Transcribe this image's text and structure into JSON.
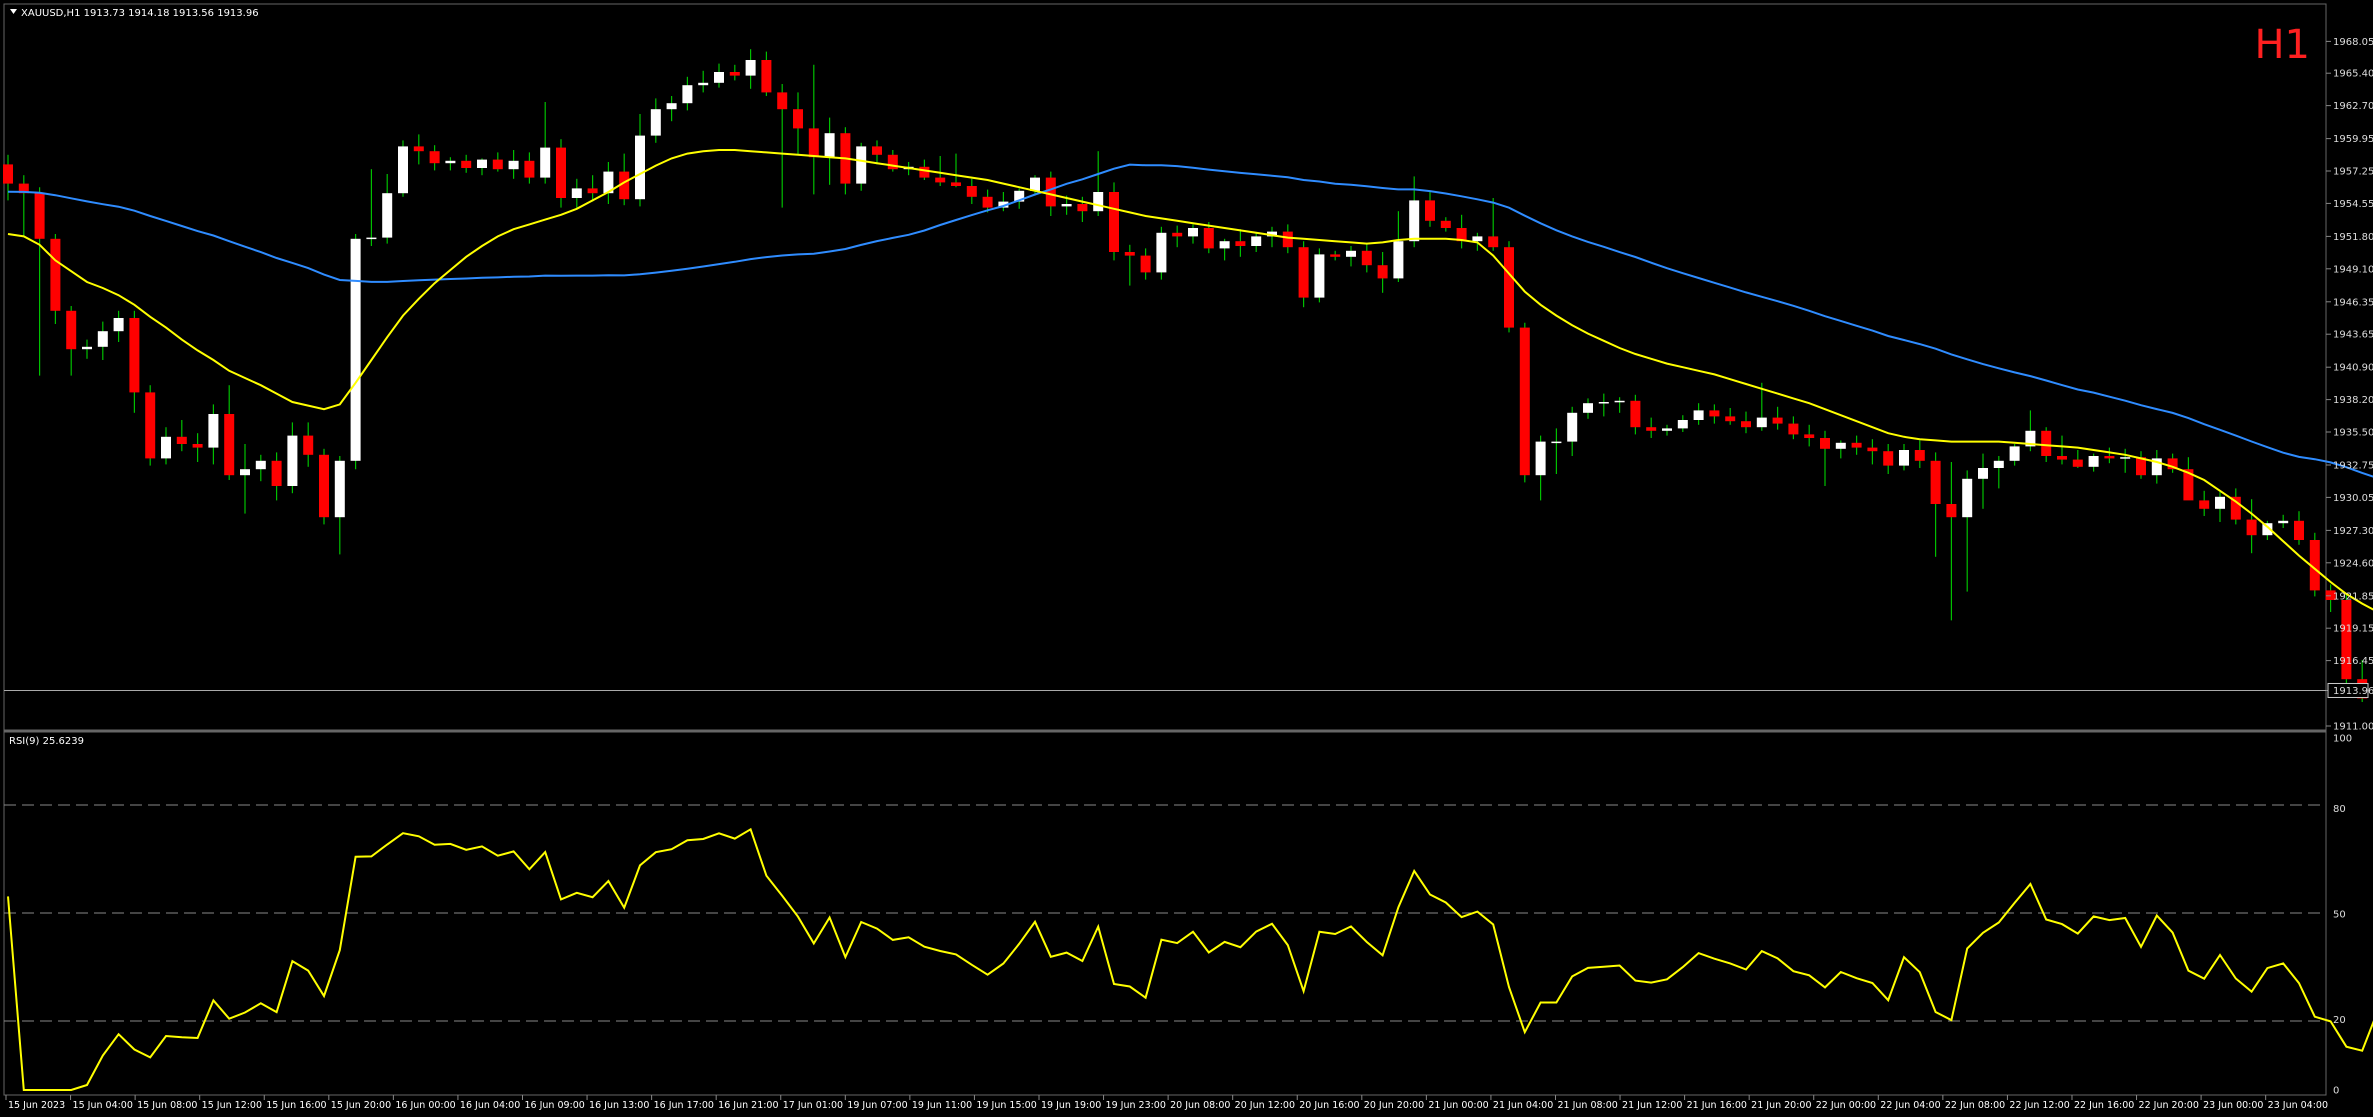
{
  "header": {
    "symbol_line": "XAUUSD,H1  1913.73 1914.18 1913.56 1913.96",
    "timeframe_badge": "H1"
  },
  "colors": {
    "background": "#000000",
    "bull_candle": "#ffffff",
    "bear_candle": "#ff0000",
    "wick": "#00c000",
    "ma_fast": "#ffff00",
    "ma_slow": "#2f8cff",
    "rsi_line": "#ffff00",
    "grid_dash": "#888888",
    "badge": "#ff2020"
  },
  "price_axis": {
    "ticks": [
      "1968.05",
      "1965.40",
      "1962.70",
      "1959.95",
      "1957.25",
      "1954.55",
      "1951.80",
      "1949.10",
      "1946.35",
      "1943.65",
      "1940.90",
      "1938.20",
      "1935.50",
      "1932.75",
      "1930.05",
      "1927.30",
      "1924.60",
      "1921.85",
      "1919.15",
      "1916.45",
      "1913.96",
      "1911.00"
    ],
    "current_price": "1913.96"
  },
  "rsi_panel": {
    "label": "RSI(9) 25.6239",
    "ticks": [
      "100",
      "80",
      "50",
      "20",
      "0"
    ]
  },
  "time_axis": {
    "labels": [
      "15 Jun 2023",
      "15 Jun 04:00",
      "15 Jun 08:00",
      "15 Jun 12:00",
      "15 Jun 16:00",
      "15 Jun 20:00",
      "16 Jun 00:00",
      "16 Jun 04:00",
      "16 Jun 09:00",
      "16 Jun 13:00",
      "16 Jun 17:00",
      "16 Jun 21:00",
      "17 Jun 01:00",
      "19 Jun 07:00",
      "19 Jun 11:00",
      "19 Jun 15:00",
      "19 Jun 19:00",
      "19 Jun 23:00",
      "20 Jun 08:00",
      "20 Jun 12:00",
      "20 Jun 16:00",
      "20 Jun 20:00",
      "21 Jun 00:00",
      "21 Jun 04:00",
      "21 Jun 08:00",
      "21 Jun 12:00",
      "21 Jun 16:00",
      "21 Jun 20:00",
      "22 Jun 00:00",
      "22 Jun 04:00",
      "22 Jun 08:00",
      "22 Jun 12:00",
      "22 Jun 16:00",
      "22 Jun 20:00",
      "23 Jun 00:00",
      "23 Jun 04:00"
    ]
  },
  "chart_data": {
    "type": "candlestick",
    "symbol": "XAUUSD",
    "timeframe": "H1",
    "ylim": [
      1911.0,
      1969.5
    ],
    "candles": [
      [
        1957.8,
        1958.6,
        1954.8,
        1956.2
      ],
      [
        1956.2,
        1956.9,
        1951.8,
        1955.4
      ],
      [
        1955.4,
        1955.9,
        1940.2,
        1951.6
      ],
      [
        1951.6,
        1952.0,
        1944.5,
        1945.6
      ],
      [
        1945.6,
        1946.0,
        1940.2,
        1942.4
      ],
      [
        1942.4,
        1943.2,
        1941.6,
        1942.6
      ],
      [
        1942.6,
        1944.7,
        1941.5,
        1943.9
      ],
      [
        1943.9,
        1945.6,
        1943.0,
        1945.0
      ],
      [
        1945.0,
        1945.6,
        1937.1,
        1938.8
      ],
      [
        1938.8,
        1939.4,
        1932.7,
        1933.3
      ],
      [
        1933.3,
        1935.9,
        1932.8,
        1935.1
      ],
      [
        1935.1,
        1936.5,
        1933.9,
        1934.5
      ],
      [
        1934.5,
        1935.4,
        1933.0,
        1934.2
      ],
      [
        1934.2,
        1937.8,
        1932.8,
        1937.0
      ],
      [
        1937.0,
        1939.4,
        1931.5,
        1931.9
      ],
      [
        1931.9,
        1934.5,
        1928.7,
        1932.4
      ],
      [
        1932.4,
        1933.6,
        1931.4,
        1933.1
      ],
      [
        1933.1,
        1933.8,
        1929.8,
        1931.0
      ],
      [
        1931.0,
        1936.3,
        1930.4,
        1935.2
      ],
      [
        1935.2,
        1936.3,
        1932.6,
        1933.6
      ],
      [
        1933.6,
        1934.1,
        1927.8,
        1928.4
      ],
      [
        1928.4,
        1933.5,
        1925.3,
        1933.1
      ],
      [
        1933.1,
        1952.0,
        1932.4,
        1951.6
      ],
      [
        1951.6,
        1957.4,
        1951.0,
        1951.7
      ],
      [
        1951.7,
        1957.0,
        1951.2,
        1955.4
      ],
      [
        1955.4,
        1959.8,
        1955.1,
        1959.3
      ],
      [
        1959.3,
        1960.3,
        1957.8,
        1958.9
      ],
      [
        1958.9,
        1959.4,
        1957.3,
        1957.9
      ],
      [
        1957.9,
        1958.4,
        1957.3,
        1958.1
      ],
      [
        1958.1,
        1958.6,
        1957.1,
        1957.5
      ],
      [
        1957.5,
        1958.3,
        1956.9,
        1958.2
      ],
      [
        1958.2,
        1958.8,
        1957.2,
        1957.4
      ],
      [
        1957.4,
        1959.0,
        1956.6,
        1958.1
      ],
      [
        1958.1,
        1958.8,
        1956.2,
        1956.7
      ],
      [
        1956.7,
        1963.0,
        1956.2,
        1959.2
      ],
      [
        1959.2,
        1959.9,
        1954.2,
        1955.0
      ],
      [
        1955.0,
        1956.6,
        1954.1,
        1955.8
      ],
      [
        1955.8,
        1956.9,
        1954.7,
        1955.4
      ],
      [
        1955.4,
        1958.0,
        1954.5,
        1957.2
      ],
      [
        1957.2,
        1958.7,
        1954.4,
        1954.9
      ],
      [
        1954.9,
        1962.0,
        1954.3,
        1960.2
      ],
      [
        1960.2,
        1963.3,
        1959.6,
        1962.4
      ],
      [
        1962.4,
        1963.5,
        1961.4,
        1962.9
      ],
      [
        1962.9,
        1965.1,
        1962.3,
        1964.4
      ],
      [
        1964.4,
        1965.6,
        1963.8,
        1964.6
      ],
      [
        1964.6,
        1966.2,
        1964.2,
        1965.5
      ],
      [
        1965.5,
        1966.1,
        1964.8,
        1965.2
      ],
      [
        1965.2,
        1967.4,
        1964.1,
        1966.5
      ],
      [
        1966.5,
        1967.2,
        1963.5,
        1963.8
      ],
      [
        1963.8,
        1964.5,
        1954.2,
        1962.4
      ],
      [
        1962.4,
        1963.8,
        1958.6,
        1960.8
      ],
      [
        1960.8,
        1966.1,
        1955.3,
        1958.4
      ],
      [
        1958.4,
        1961.7,
        1956.1,
        1960.4
      ],
      [
        1960.4,
        1960.9,
        1955.3,
        1956.2
      ],
      [
        1956.2,
        1959.6,
        1955.6,
        1959.3
      ],
      [
        1959.3,
        1959.8,
        1957.8,
        1958.6
      ],
      [
        1958.6,
        1959.0,
        1957.2,
        1957.4
      ],
      [
        1957.4,
        1958.0,
        1956.9,
        1957.6
      ],
      [
        1957.6,
        1958.2,
        1956.5,
        1956.7
      ],
      [
        1956.7,
        1958.5,
        1956.0,
        1956.3
      ],
      [
        1956.3,
        1958.7,
        1955.9,
        1956.0
      ],
      [
        1956.0,
        1956.6,
        1954.5,
        1955.1
      ],
      [
        1955.1,
        1955.7,
        1953.8,
        1954.2
      ],
      [
        1954.2,
        1955.5,
        1953.9,
        1954.7
      ],
      [
        1954.7,
        1955.8,
        1954.1,
        1955.6
      ],
      [
        1955.6,
        1956.9,
        1955.2,
        1956.7
      ],
      [
        1956.7,
        1957.2,
        1953.5,
        1954.3
      ],
      [
        1954.3,
        1955.2,
        1953.6,
        1954.5
      ],
      [
        1954.5,
        1955.1,
        1953.0,
        1953.9
      ],
      [
        1953.9,
        1958.9,
        1953.5,
        1955.5
      ],
      [
        1955.5,
        1956.3,
        1949.8,
        1950.5
      ],
      [
        1950.5,
        1951.1,
        1947.7,
        1950.2
      ],
      [
        1950.2,
        1950.8,
        1948.2,
        1948.8
      ],
      [
        1948.8,
        1952.6,
        1948.2,
        1952.1
      ],
      [
        1952.1,
        1952.7,
        1950.9,
        1951.8
      ],
      [
        1951.8,
        1952.8,
        1951.2,
        1952.5
      ],
      [
        1952.5,
        1953.0,
        1950.4,
        1950.8
      ],
      [
        1950.8,
        1951.6,
        1949.8,
        1951.4
      ],
      [
        1951.4,
        1952.4,
        1950.1,
        1951.0
      ],
      [
        1951.0,
        1952.1,
        1950.5,
        1951.8
      ],
      [
        1951.8,
        1952.6,
        1950.9,
        1952.2
      ],
      [
        1952.2,
        1952.8,
        1950.4,
        1950.9
      ],
      [
        1950.9,
        1951.4,
        1945.9,
        1946.7
      ],
      [
        1946.7,
        1950.8,
        1946.3,
        1950.3
      ],
      [
        1950.3,
        1950.6,
        1949.8,
        1950.1
      ],
      [
        1950.1,
        1951.0,
        1949.3,
        1950.6
      ],
      [
        1950.6,
        1951.2,
        1948.8,
        1949.4
      ],
      [
        1949.4,
        1950.5,
        1947.1,
        1948.3
      ],
      [
        1948.3,
        1953.9,
        1948.0,
        1951.4
      ],
      [
        1951.4,
        1956.8,
        1950.9,
        1954.8
      ],
      [
        1954.8,
        1955.5,
        1952.6,
        1953.1
      ],
      [
        1953.1,
        1953.4,
        1952.2,
        1952.5
      ],
      [
        1952.5,
        1953.6,
        1950.8,
        1951.4
      ],
      [
        1951.4,
        1952.1,
        1950.6,
        1951.8
      ],
      [
        1951.8,
        1955.0,
        1950.6,
        1950.9
      ],
      [
        1950.9,
        1951.4,
        1943.8,
        1944.2
      ],
      [
        1944.2,
        1944.6,
        1931.3,
        1931.9
      ],
      [
        1931.9,
        1935.2,
        1929.8,
        1934.7
      ],
      [
        1934.7,
        1935.8,
        1932.0,
        1934.7
      ],
      [
        1934.7,
        1937.6,
        1933.5,
        1937.1
      ],
      [
        1937.1,
        1938.3,
        1936.6,
        1937.9
      ],
      [
        1937.9,
        1938.7,
        1936.8,
        1938.0
      ],
      [
        1938.0,
        1938.4,
        1937.1,
        1938.1
      ],
      [
        1938.1,
        1938.6,
        1935.3,
        1935.9
      ],
      [
        1935.9,
        1936.7,
        1935.0,
        1935.6
      ],
      [
        1935.6,
        1936.1,
        1935.2,
        1935.8
      ],
      [
        1935.8,
        1936.9,
        1935.5,
        1936.5
      ],
      [
        1936.5,
        1937.9,
        1936.1,
        1937.3
      ],
      [
        1937.3,
        1937.8,
        1936.2,
        1936.8
      ],
      [
        1936.8,
        1937.5,
        1936.1,
        1936.4
      ],
      [
        1936.4,
        1937.2,
        1935.4,
        1935.9
      ],
      [
        1935.9,
        1939.6,
        1935.6,
        1936.7
      ],
      [
        1936.7,
        1937.6,
        1935.7,
        1936.2
      ],
      [
        1936.2,
        1936.8,
        1934.9,
        1935.3
      ],
      [
        1935.3,
        1936.1,
        1934.3,
        1935.0
      ],
      [
        1935.0,
        1935.6,
        1931.0,
        1934.1
      ],
      [
        1934.1,
        1934.8,
        1933.3,
        1934.6
      ],
      [
        1934.6,
        1935.2,
        1933.6,
        1934.2
      ],
      [
        1934.2,
        1934.9,
        1932.8,
        1933.9
      ],
      [
        1933.9,
        1934.5,
        1932.0,
        1932.7
      ],
      [
        1932.7,
        1934.5,
        1932.3,
        1934.0
      ],
      [
        1934.0,
        1934.8,
        1932.5,
        1933.1
      ],
      [
        1933.1,
        1933.8,
        1925.1,
        1929.5
      ],
      [
        1929.5,
        1933.0,
        1919.8,
        1928.4
      ],
      [
        1928.4,
        1932.3,
        1922.2,
        1931.6
      ],
      [
        1931.6,
        1933.7,
        1929.1,
        1932.5
      ],
      [
        1932.5,
        1933.5,
        1930.8,
        1933.1
      ],
      [
        1933.1,
        1934.5,
        1932.7,
        1934.3
      ],
      [
        1934.3,
        1937.3,
        1933.9,
        1935.6
      ],
      [
        1935.6,
        1935.9,
        1933.0,
        1933.5
      ],
      [
        1933.5,
        1935.2,
        1932.8,
        1933.2
      ],
      [
        1933.2,
        1934.0,
        1932.5,
        1932.6
      ],
      [
        1932.6,
        1933.7,
        1932.2,
        1933.5
      ],
      [
        1933.5,
        1934.2,
        1932.9,
        1933.3
      ],
      [
        1933.3,
        1934.1,
        1932.1,
        1933.4
      ],
      [
        1933.4,
        1933.9,
        1931.6,
        1931.9
      ],
      [
        1931.9,
        1934.0,
        1931.2,
        1933.3
      ],
      [
        1933.3,
        1933.7,
        1932.1,
        1932.4
      ],
      [
        1932.4,
        1933.4,
        1930.1,
        1929.8
      ],
      [
        1929.8,
        1930.6,
        1928.5,
        1929.1
      ],
      [
        1929.1,
        1930.5,
        1928.0,
        1930.1
      ],
      [
        1930.1,
        1930.8,
        1927.8,
        1928.2
      ],
      [
        1928.2,
        1929.9,
        1925.4,
        1926.9
      ],
      [
        1926.9,
        1928.1,
        1926.5,
        1927.9
      ],
      [
        1927.9,
        1928.6,
        1927.5,
        1928.1
      ],
      [
        1928.1,
        1928.9,
        1926.1,
        1926.5
      ],
      [
        1926.5,
        1927.1,
        1921.8,
        1922.3
      ],
      [
        1922.3,
        1922.8,
        1920.5,
        1921.5
      ],
      [
        1921.5,
        1921.9,
        1914.5,
        1914.9
      ],
      [
        1914.9,
        1916.5,
        1913.0,
        1913.3
      ],
      [
        1913.3,
        1916.2,
        1913.1,
        1915.6
      ],
      [
        1915.6,
        1917.0,
        1914.8,
        1916.5
      ],
      [
        1916.5,
        1917.0,
        1914.6,
        1915.3
      ],
      [
        1915.3,
        1915.8,
        1913.9,
        1914.2
      ],
      [
        1914.2,
        1914.6,
        1912.6,
        1913.8
      ],
      [
        1913.8,
        1914.2,
        1913.4,
        1913.9
      ],
      [
        1913.73,
        1914.18,
        1913.56,
        1913.96
      ]
    ],
    "ma_fast": [
      1952.0,
      1951.8,
      1951.1,
      1949.8,
      1948.9,
      1948.0,
      1947.5,
      1946.9,
      1946.1,
      1945.1,
      1944.2,
      1943.2,
      1942.3,
      1941.5,
      1940.6,
      1940.0,
      1939.4,
      1938.7,
      1938.0,
      1937.7,
      1937.4,
      1937.8,
      1939.6,
      1941.5,
      1943.4,
      1945.2,
      1946.6,
      1947.9,
      1949.0,
      1950.1,
      1951.0,
      1951.8,
      1952.4,
      1952.8,
      1953.2,
      1953.6,
      1954.1,
      1954.8,
      1955.5,
      1956.3,
      1957.0,
      1957.7,
      1958.3,
      1958.7,
      1958.9,
      1959.0,
      1959.0,
      1958.9,
      1958.8,
      1958.7,
      1958.6,
      1958.5,
      1958.4,
      1958.3,
      1958.1,
      1957.9,
      1957.7,
      1957.5,
      1957.3,
      1957.1,
      1956.9,
      1956.7,
      1956.5,
      1956.2,
      1955.9,
      1955.6,
      1955.3,
      1955.0,
      1954.7,
      1954.4,
      1954.1,
      1953.8,
      1953.5,
      1953.3,
      1953.1,
      1952.9,
      1952.7,
      1952.5,
      1952.3,
      1952.1,
      1951.9,
      1951.7,
      1951.6,
      1951.5,
      1951.4,
      1951.3,
      1951.2,
      1951.3,
      1951.5,
      1951.6,
      1951.6,
      1951.6,
      1951.5,
      1951.3,
      1950.2,
      1948.7,
      1947.2,
      1946.1,
      1945.2,
      1944.4,
      1943.7,
      1943.1,
      1942.5,
      1942.0,
      1941.6,
      1941.2,
      1940.9,
      1940.6,
      1940.3,
      1939.9,
      1939.5,
      1939.1,
      1938.7,
      1938.3,
      1937.9,
      1937.4,
      1936.9,
      1936.4,
      1935.9,
      1935.4,
      1935.1,
      1934.9,
      1934.8,
      1934.7,
      1934.7,
      1934.7,
      1934.7,
      1934.6,
      1934.5,
      1934.4,
      1934.3,
      1934.2,
      1934.0,
      1933.8,
      1933.6,
      1933.3,
      1933.0,
      1932.6,
      1932.1,
      1931.5,
      1930.6,
      1929.7,
      1928.7,
      1927.6,
      1926.4,
      1925.2,
      1924.1,
      1923.0,
      1922.0,
      1921.2,
      1920.5
    ]
  }
}
